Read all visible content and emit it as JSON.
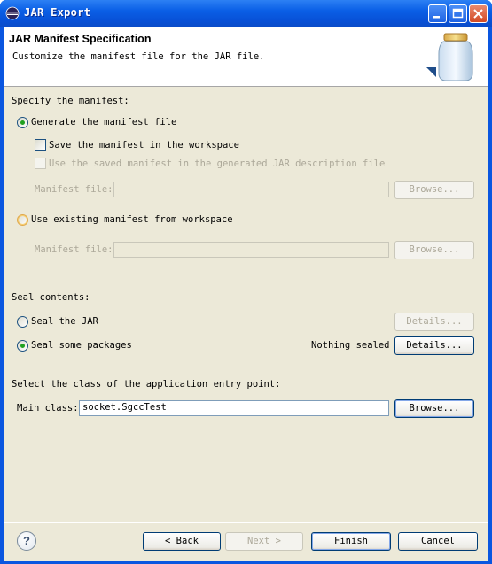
{
  "window": {
    "title": "JAR Export"
  },
  "header": {
    "title": "JAR Manifest Specification",
    "description": "Customize the manifest file for the JAR file."
  },
  "manifest": {
    "section_label": "Specify the manifest:",
    "generate": {
      "label": "Generate the manifest file",
      "selected": true
    },
    "save_in_workspace": {
      "label": "Save the manifest in the workspace",
      "checked": false
    },
    "use_saved": {
      "label": "Use the saved manifest in the generated JAR description file",
      "enabled": false
    },
    "file1_label": "Manifest file:",
    "file1_value": "",
    "browse1": "Browse...",
    "use_existing": {
      "label": "Use existing manifest from workspace",
      "selected": false
    },
    "file2_label": "Manifest file:",
    "file2_value": "",
    "browse2": "Browse..."
  },
  "seal": {
    "section_label": "Seal contents:",
    "seal_jar": {
      "label": "Seal the JAR",
      "selected": false
    },
    "details1": "Details...",
    "seal_some": {
      "label": "Seal some packages",
      "selected": true
    },
    "status": "Nothing sealed",
    "details2": "Details..."
  },
  "entry": {
    "section_label": "Select the class of the application entry point:",
    "main_class_label": "Main class:",
    "main_class_value": "socket.SgccTest",
    "browse": "Browse..."
  },
  "footer": {
    "back": "< Back",
    "next": "Next >",
    "finish": "Finish",
    "cancel": "Cancel"
  },
  "icons": [
    "eclipse-app-icon",
    "minimize-icon",
    "maximize-icon",
    "close-icon",
    "jar-icon",
    "help-icon"
  ],
  "colors": {
    "titlebar": "#0a5fe6",
    "dialog_bg": "#ece9d8",
    "radio_selected": "#21a121"
  }
}
